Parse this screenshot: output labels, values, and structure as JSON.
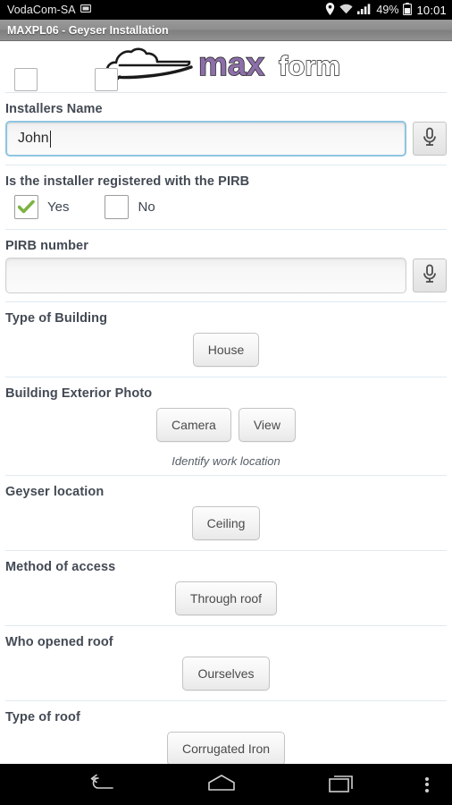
{
  "status_bar": {
    "carrier": "VodaCom-SA",
    "sim_icon": "sim-card-icon",
    "location_icon": "location-pin-icon",
    "wifi_icon": "wifi-icon",
    "signal_icon": "signal-bars-icon",
    "battery_percent": "49%",
    "battery_icon": "battery-icon",
    "clock": "10:01"
  },
  "title_bar": {
    "title": "MAXPL06 - Geyser Installation"
  },
  "logo": {
    "text_max": "max",
    "text_form": "form",
    "cloud_icon": "cloud-icon",
    "accent_color": "#8c6fa8"
  },
  "form": {
    "installers_name": {
      "label": "Installers Name",
      "value": "John",
      "placeholder": "",
      "mic_icon": "microphone-icon",
      "focused": true
    },
    "pirb_registered": {
      "label": "Is the installer registered with the PIRB",
      "options": [
        {
          "label": "Yes",
          "checked": true
        },
        {
          "label": "No",
          "checked": false
        }
      ],
      "check_color": "#7cb342"
    },
    "pirb_number": {
      "label": "PIRB number",
      "value": "",
      "placeholder": "",
      "mic_icon": "microphone-icon",
      "focused": false
    },
    "type_of_building": {
      "label": "Type of Building",
      "buttons": [
        "House"
      ]
    },
    "building_exterior_photo": {
      "label": "Building Exterior Photo",
      "buttons": [
        "Camera",
        "View"
      ],
      "hint": "Identify work location"
    },
    "geyser_location": {
      "label": "Geyser location",
      "buttons": [
        "Ceiling"
      ]
    },
    "method_of_access": {
      "label": "Method of access",
      "buttons": [
        "Through roof"
      ]
    },
    "who_opened_roof": {
      "label": "Who opened roof",
      "buttons": [
        "Ourselves"
      ]
    },
    "type_of_roof": {
      "label": "Type of roof",
      "buttons": [
        "Corrugated Iron"
      ]
    }
  },
  "nav_bar": {
    "back_icon": "back-arrow-icon",
    "home_icon": "home-icon",
    "recents_icon": "recent-apps-icon",
    "menu_icon": "overflow-menu-icon"
  }
}
